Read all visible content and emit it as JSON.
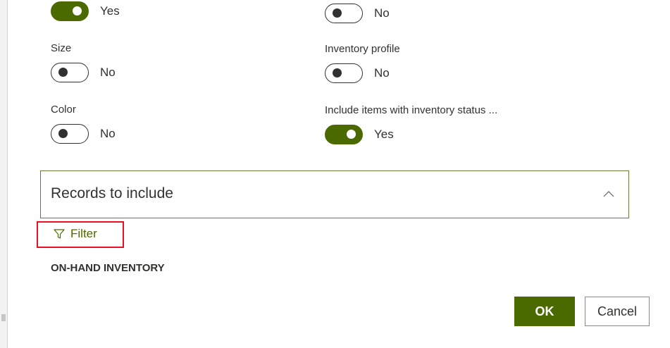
{
  "fields": {
    "top_left": {
      "label": "",
      "state": "on",
      "text": "Yes"
    },
    "top_right": {
      "label": "",
      "state": "off",
      "text": "No"
    },
    "size": {
      "label": "Size",
      "state": "off",
      "text": "No"
    },
    "inventory_profile": {
      "label": "Inventory profile",
      "state": "off",
      "text": "No"
    },
    "color": {
      "label": "Color",
      "state": "off",
      "text": "No"
    },
    "include_items": {
      "label": "Include items with inventory status ...",
      "state": "on",
      "text": "Yes"
    }
  },
  "records": {
    "title": "Records to include",
    "filter_label": "Filter",
    "heading": "ON-HAND INVENTORY"
  },
  "buttons": {
    "ok": "OK",
    "cancel": "Cancel"
  },
  "colors": {
    "accent": "#4a6a00",
    "highlight": "#e81123"
  }
}
